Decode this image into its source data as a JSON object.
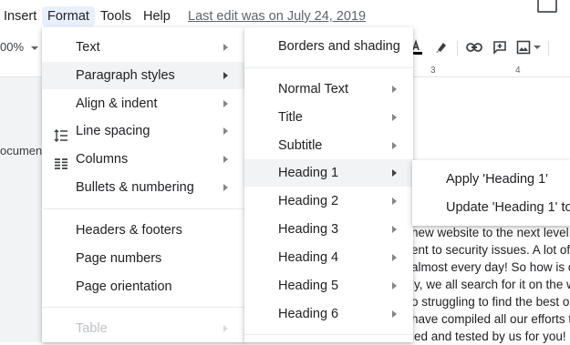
{
  "menubar": {
    "items": [
      "Insert",
      "Format",
      "Tools",
      "Help"
    ],
    "last_edit": "Last edit was on July 24, 2019"
  },
  "toolbar": {
    "zoom": "00%"
  },
  "ruler": {
    "ticks": [
      "3",
      "4"
    ]
  },
  "document": {
    "side_label": "ocumen",
    "lines": [
      "new website to the next level. T",
      "ent to security issues. A lot of J",
      "almost every day! So how is on",
      "ly, we all search for it on the w",
      "o struggling to find the best on",
      "have compiled all our efforts t",
      "ied and tested by us for you! S"
    ]
  },
  "format_menu": {
    "items": [
      {
        "label": "Text",
        "submenu": true
      },
      {
        "label": "Paragraph styles",
        "submenu": true,
        "highlighted": true
      },
      {
        "label": "Align & indent",
        "submenu": true
      },
      {
        "label": "Line spacing",
        "submenu": true,
        "icon": "line-spacing-icon"
      },
      {
        "label": "Columns",
        "submenu": true,
        "icon": "columns-icon"
      },
      {
        "label": "Bullets & numbering",
        "submenu": true
      },
      {
        "label": "Headers & footers"
      },
      {
        "label": "Page numbers"
      },
      {
        "label": "Page orientation"
      },
      {
        "label": "Table",
        "submenu": true,
        "disabled": true
      }
    ]
  },
  "paragraph_styles_menu": {
    "items": [
      {
        "label": "Borders and shading"
      },
      {
        "label": "Normal Text",
        "submenu": true
      },
      {
        "label": "Title",
        "submenu": true
      },
      {
        "label": "Subtitle",
        "submenu": true
      },
      {
        "label": "Heading 1",
        "submenu": true,
        "highlighted": true
      },
      {
        "label": "Heading 2",
        "submenu": true
      },
      {
        "label": "Heading 3",
        "submenu": true
      },
      {
        "label": "Heading 4",
        "submenu": true
      },
      {
        "label": "Heading 5",
        "submenu": true
      },
      {
        "label": "Heading 6",
        "submenu": true
      }
    ]
  },
  "heading_menu": {
    "items": [
      "Apply 'Heading 1'",
      "Update 'Heading 1' to"
    ]
  },
  "colors": {
    "highlight": "#f1f3f4",
    "active_menu": "#e8f0fe",
    "doc_background": "#f1f3f4"
  }
}
